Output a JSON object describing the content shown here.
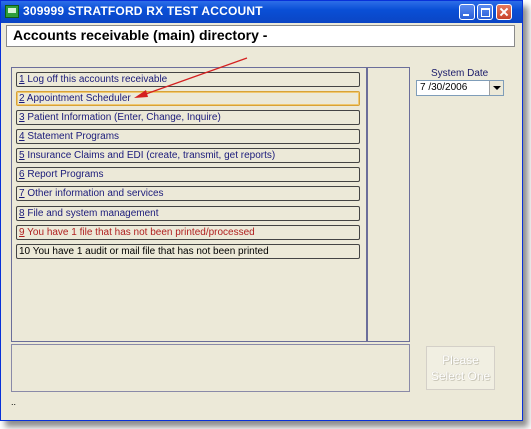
{
  "window": {
    "title": "309999 STRATFORD RX TEST ACCOUNT",
    "icon": "app-icon"
  },
  "header": {
    "title": "Accounts receivable (main) directory -"
  },
  "menu": {
    "items": [
      {
        "key": "1",
        "label": " Log off this accounts receivable",
        "style": "normal"
      },
      {
        "key": "2",
        "label": " Appointment Scheduler",
        "style": "selected"
      },
      {
        "key": "3",
        "label": " Patient Information (Enter, Change, Inquire)",
        "style": "normal"
      },
      {
        "key": "4",
        "label": " Statement Programs",
        "style": "normal"
      },
      {
        "key": "5",
        "label": " Insurance Claims and EDI (create, transmit, get reports)",
        "style": "normal"
      },
      {
        "key": "6",
        "label": " Report Programs",
        "style": "normal"
      },
      {
        "key": "7",
        "label": " Other information and services",
        "style": "normal"
      },
      {
        "key": "8",
        "label": " File and system management",
        "style": "normal"
      },
      {
        "key": "9",
        "label": " You have 1 file that has not been printed/processed",
        "style": "alert"
      },
      {
        "key": "10",
        "label": " You have 1 audit or mail file that has not been printed",
        "style": "plain"
      }
    ]
  },
  "system_date": {
    "label": "System Date",
    "value": "7 /30/2006"
  },
  "select_button": {
    "line1": "Please",
    "line2": "Select One"
  },
  "status": {
    "text": ".."
  },
  "colors": {
    "title_bar": "#0a4fd6",
    "annotation_arrow": "#d42020",
    "menu_text": "#1a1a7a",
    "alert_text": "#b02020"
  }
}
